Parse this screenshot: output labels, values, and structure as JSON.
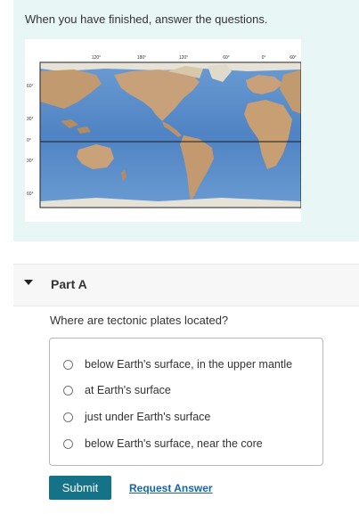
{
  "intro": {
    "text": "When you have finished, answer the questions."
  },
  "map": {
    "longitude_labels": [
      "120°",
      "180°",
      "120°",
      "60°",
      "0°",
      "60°"
    ],
    "latitude_labels": [
      "60°",
      "30°",
      "0°",
      "30°",
      "60°"
    ],
    "colors": {
      "ocean": "#5b8fc9",
      "ocean_deep": "#3f73b5",
      "land": "#c9a27a",
      "land_dark": "#a87e57",
      "ice": "#e8e4dc"
    }
  },
  "part": {
    "title": "Part A",
    "question": "Where are tectonic plates located?",
    "options": [
      "below Earth's surface, in the upper mantle",
      "at Earth's surface",
      "just under Earth's surface",
      "below Earth's surface, near the core"
    ]
  },
  "actions": {
    "submit_label": "Submit",
    "request_label": "Request Answer"
  },
  "colors": {
    "panel_bg": "#e8f6f6",
    "submit_bg": "#157389",
    "link": "#1665a8"
  }
}
